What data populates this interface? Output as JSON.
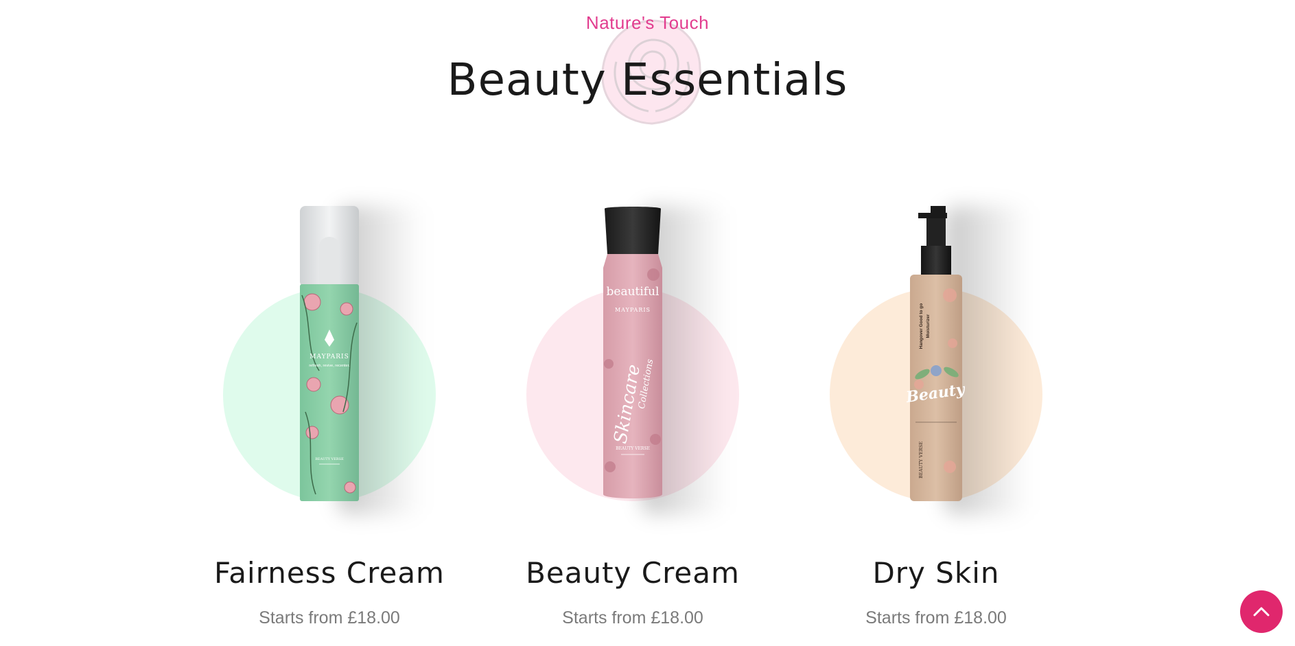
{
  "section": {
    "eyebrow": "Nature's Touch",
    "title": "Beauty Essentials"
  },
  "colors": {
    "accent": "#e23d8f",
    "scroll_button": "#e0276d",
    "card1_circle": "#dffbec",
    "card2_circle": "#fde8ee",
    "card3_circle": "#fdebd9"
  },
  "products": [
    {
      "name": "Fairness Cream",
      "price": "Starts from £18.00",
      "label_brand": "MAYPARIS",
      "label_tagline": "refresh, revive, recenter.",
      "label_line": "BEAUTY VERSE"
    },
    {
      "name": "Beauty Cream",
      "price": "Starts from £18.00",
      "label_brand": "MAYPARIS",
      "label_word": "beautiful",
      "label_script": "Skincare Collections",
      "label_line": "BEAUTY VERSE"
    },
    {
      "name": "Dry Skin",
      "price": "Starts from £18.00",
      "label_vertical": "Hangover Good to go Moisturizer",
      "label_script": "Beauty",
      "label_line": "BEAUTY VERSE"
    }
  ],
  "scroll_top": {
    "icon": "chevron-up-icon"
  }
}
